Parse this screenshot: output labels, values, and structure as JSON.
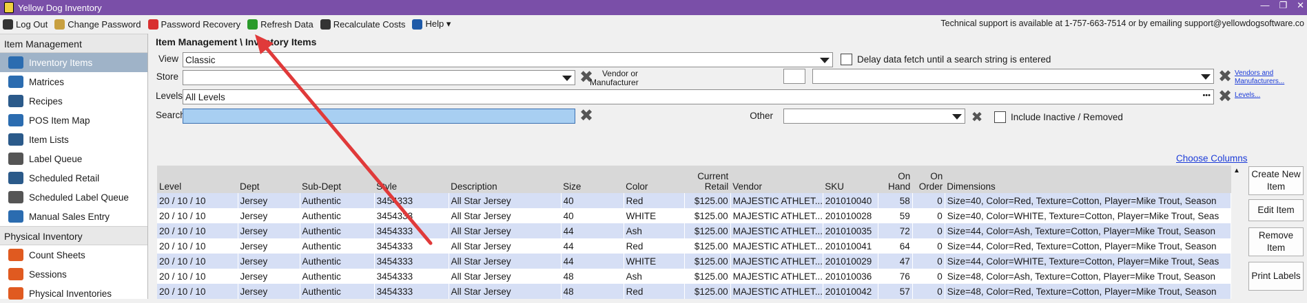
{
  "window": {
    "title": "Yellow Dog Inventory",
    "controls": [
      "—",
      "❐",
      "✕"
    ]
  },
  "menubar": {
    "items": [
      {
        "label": "Log Out",
        "icon": "logout-icon",
        "color": "#333333"
      },
      {
        "label": "Change Password",
        "icon": "key-icon",
        "color": "#c8a040"
      },
      {
        "label": "Password Recovery",
        "icon": "lifebuoy-icon",
        "color": "#d83030"
      },
      {
        "label": "Refresh Data",
        "icon": "refresh-icon",
        "color": "#2a9a2a"
      },
      {
        "label": "Recalculate Costs",
        "icon": "bank-icon",
        "color": "#333333"
      },
      {
        "label": "Help ▾",
        "icon": "help-icon",
        "color": "#1e5aa8"
      }
    ],
    "support_text": "Technical support is available at 1-757-663-7514 or by emailing support@yellowdogsoftware.co"
  },
  "sidebar": {
    "sections": [
      {
        "title": "Item Management",
        "items": [
          {
            "label": "Inventory Items",
            "icon": "tag-icon",
            "active": true,
            "color": "#2b6cb0"
          },
          {
            "label": "Matrices",
            "icon": "matrix-icon",
            "active": false,
            "color": "#2b6cb0"
          },
          {
            "label": "Recipes",
            "icon": "utensils-icon",
            "active": false,
            "color": "#2b5a8a"
          },
          {
            "label": "POS Item Map",
            "icon": "sitemap-icon",
            "active": false,
            "color": "#2b6cb0"
          },
          {
            "label": "Item Lists",
            "icon": "list-icon",
            "active": false,
            "color": "#2b5a8a"
          },
          {
            "label": "Label Queue",
            "icon": "barcode-icon",
            "active": false,
            "color": "#555555"
          },
          {
            "label": "Scheduled Retail",
            "icon": "clock-icon",
            "active": false,
            "color": "#2b5a8a"
          },
          {
            "label": "Scheduled Label Queue",
            "icon": "barcode-icon",
            "active": false,
            "color": "#555555"
          },
          {
            "label": "Manual Sales Entry",
            "icon": "edit-icon",
            "active": false,
            "color": "#2b6cb0"
          }
        ]
      },
      {
        "title": "Physical Inventory",
        "items": [
          {
            "label": "Count Sheets",
            "icon": "paper-plane-icon",
            "active": false,
            "color": "#e05a20"
          },
          {
            "label": "Sessions",
            "icon": "sessions-icon",
            "active": false,
            "color": "#e05a20"
          },
          {
            "label": "Physical Inventories",
            "icon": "inventory-icon",
            "active": false,
            "color": "#e05a20"
          }
        ]
      }
    ]
  },
  "main": {
    "breadcrumb": "Item Management \\ Inventory Items",
    "filters": {
      "view_label": "View",
      "view_value": "Classic",
      "delay_label": "Delay data fetch until a search string is entered",
      "store_label": "Store",
      "store_value": "",
      "vendor_label": "Vendor or Manufacturer",
      "vendor_link": "Vendors and Manufacturers...",
      "levels_label": "Levels",
      "levels_value": "All Levels",
      "levels_ellipsis": "•••",
      "levels_link": "Levels...",
      "search_label": "Search",
      "search_value": "",
      "other_label": "Other",
      "other_value": "",
      "inactive_label": "Include Inactive / Removed",
      "choose_columns": "Choose Columns"
    },
    "grid": {
      "columns": [
        "Level",
        "Dept",
        "Sub-Dept",
        "Style",
        "Description",
        "Size",
        "Color",
        "Current Retail",
        "Vendor",
        "SKU",
        "On Hand",
        "On Order",
        "Dimensions"
      ],
      "rows": [
        [
          "20 / 10 / 10",
          "Jersey",
          "Authentic",
          "3454333",
          "All Star Jersey",
          "40",
          "Red",
          "$125.00",
          "MAJESTIC ATHLET...",
          "201010040",
          "58",
          "0",
          "Size=40, Color=Red, Texture=Cotton, Player=Mike Trout, Season"
        ],
        [
          "20 / 10 / 10",
          "Jersey",
          "Authentic",
          "3454333",
          "All Star Jersey",
          "40",
          "WHITE",
          "$125.00",
          "MAJESTIC ATHLET...",
          "201010028",
          "59",
          "0",
          "Size=40, Color=WHITE, Texture=Cotton, Player=Mike Trout, Seas"
        ],
        [
          "20 / 10 / 10",
          "Jersey",
          "Authentic",
          "3454333",
          "All Star Jersey",
          "44",
          "Ash",
          "$125.00",
          "MAJESTIC ATHLET...",
          "201010035",
          "72",
          "0",
          "Size=44, Color=Ash, Texture=Cotton, Player=Mike Trout, Season"
        ],
        [
          "20 / 10 / 10",
          "Jersey",
          "Authentic",
          "3454333",
          "All Star Jersey",
          "44",
          "Red",
          "$125.00",
          "MAJESTIC ATHLET...",
          "201010041",
          "64",
          "0",
          "Size=44, Color=Red, Texture=Cotton, Player=Mike Trout, Season"
        ],
        [
          "20 / 10 / 10",
          "Jersey",
          "Authentic",
          "3454333",
          "All Star Jersey",
          "44",
          "WHITE",
          "$125.00",
          "MAJESTIC ATHLET...",
          "201010029",
          "47",
          "0",
          "Size=44, Color=WHITE, Texture=Cotton, Player=Mike Trout, Seas"
        ],
        [
          "20 / 10 / 10",
          "Jersey",
          "Authentic",
          "3454333",
          "All Star Jersey",
          "48",
          "Ash",
          "$125.00",
          "MAJESTIC ATHLET...",
          "201010036",
          "76",
          "0",
          "Size=48, Color=Ash, Texture=Cotton, Player=Mike Trout, Season"
        ],
        [
          "20 / 10 / 10",
          "Jersey",
          "Authentic",
          "3454333",
          "All Star Jersey",
          "48",
          "Red",
          "$125.00",
          "MAJESTIC ATHLET...",
          "201010042",
          "57",
          "0",
          "Size=48, Color=Red, Texture=Cotton, Player=Mike Trout, Season"
        ]
      ]
    },
    "actions": [
      "Create New Item",
      "Edit Item",
      "Remove Item",
      "Print Labels"
    ]
  },
  "annotation": {
    "color": "#e03a3a"
  }
}
